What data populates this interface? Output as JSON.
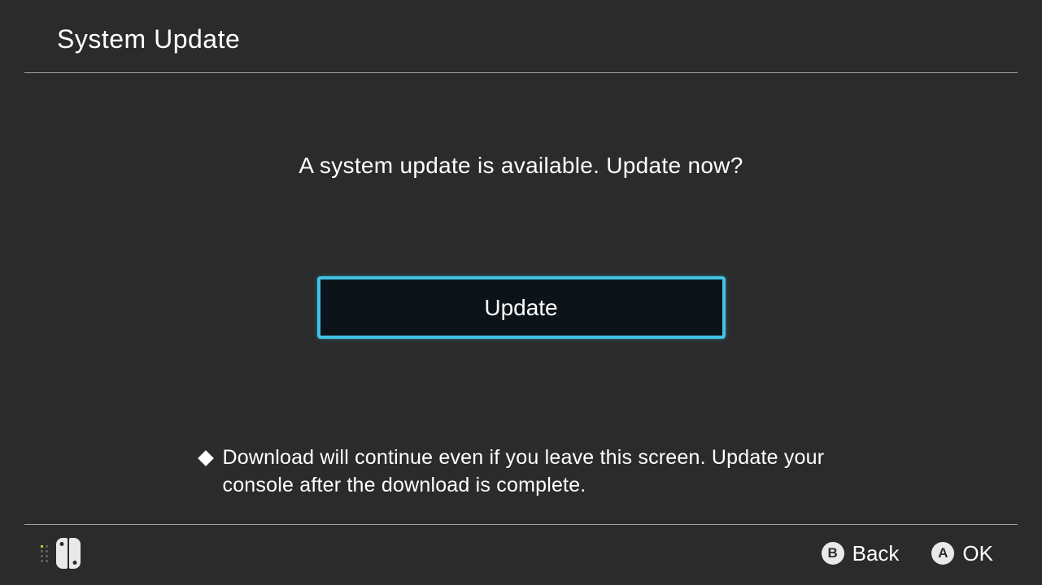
{
  "header": {
    "title": "System Update"
  },
  "main": {
    "prompt": "A system update is available. Update now?",
    "update_label": "Update",
    "note": "Download will continue even if you leave this screen. Update your console after the download is complete."
  },
  "footer": {
    "b_glyph": "B",
    "b_label": "Back",
    "a_glyph": "A",
    "a_label": "OK"
  }
}
